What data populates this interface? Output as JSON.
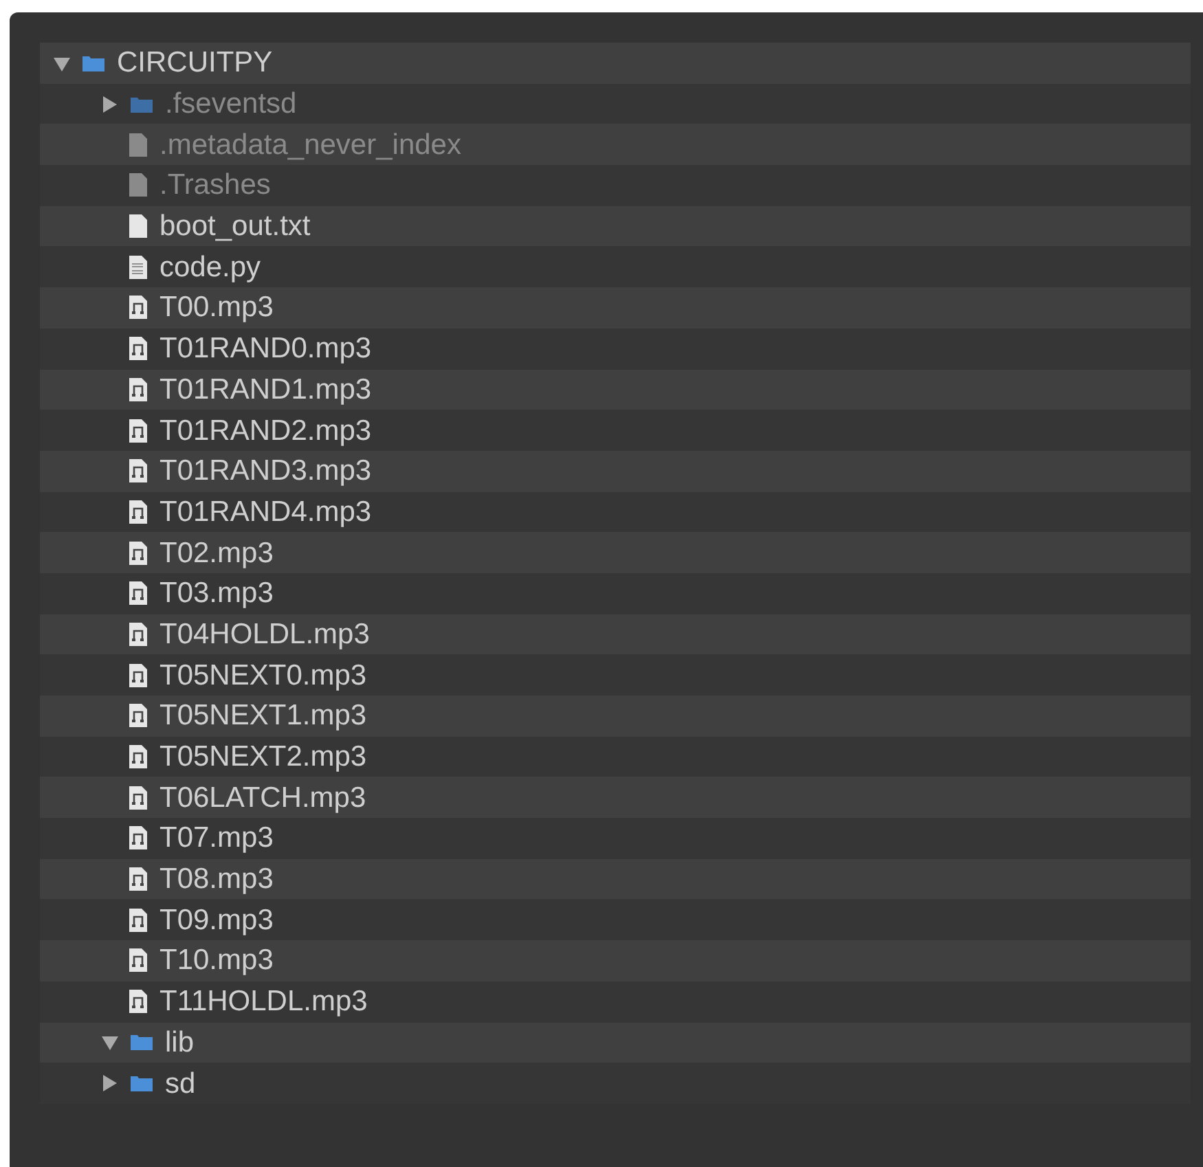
{
  "tree": [
    {
      "name": "CIRCUITPY",
      "kind": "folder",
      "expanded": true,
      "dimmed": false,
      "children": [
        {
          "name": ".fseventsd",
          "kind": "folder",
          "expanded": false,
          "dimmed": true
        },
        {
          "name": ".metadata_never_index",
          "kind": "file",
          "dimmed": true
        },
        {
          "name": ".Trashes",
          "kind": "file",
          "dimmed": true
        },
        {
          "name": "boot_out.txt",
          "kind": "file",
          "dimmed": false
        },
        {
          "name": "code.py",
          "kind": "code",
          "dimmed": false
        },
        {
          "name": "T00.mp3",
          "kind": "audio",
          "dimmed": false
        },
        {
          "name": "T01RAND0.mp3",
          "kind": "audio",
          "dimmed": false
        },
        {
          "name": "T01RAND1.mp3",
          "kind": "audio",
          "dimmed": false
        },
        {
          "name": "T01RAND2.mp3",
          "kind": "audio",
          "dimmed": false
        },
        {
          "name": "T01RAND3.mp3",
          "kind": "audio",
          "dimmed": false
        },
        {
          "name": "T01RAND4.mp3",
          "kind": "audio",
          "dimmed": false
        },
        {
          "name": "T02.mp3",
          "kind": "audio",
          "dimmed": false
        },
        {
          "name": "T03.mp3",
          "kind": "audio",
          "dimmed": false
        },
        {
          "name": "T04HOLDL.mp3",
          "kind": "audio",
          "dimmed": false
        },
        {
          "name": "T05NEXT0.mp3",
          "kind": "audio",
          "dimmed": false
        },
        {
          "name": "T05NEXT1.mp3",
          "kind": "audio",
          "dimmed": false
        },
        {
          "name": "T05NEXT2.mp3",
          "kind": "audio",
          "dimmed": false
        },
        {
          "name": "T06LATCH.mp3",
          "kind": "audio",
          "dimmed": false
        },
        {
          "name": "T07.mp3",
          "kind": "audio",
          "dimmed": false
        },
        {
          "name": "T08.mp3",
          "kind": "audio",
          "dimmed": false
        },
        {
          "name": "T09.mp3",
          "kind": "audio",
          "dimmed": false
        },
        {
          "name": "T10.mp3",
          "kind": "audio",
          "dimmed": false
        },
        {
          "name": "T11HOLDL.mp3",
          "kind": "audio",
          "dimmed": false
        },
        {
          "name": "lib",
          "kind": "folder",
          "expanded": true,
          "dimmed": false
        },
        {
          "name": "sd",
          "kind": "folder",
          "expanded": false,
          "dimmed": false
        }
      ]
    }
  ]
}
